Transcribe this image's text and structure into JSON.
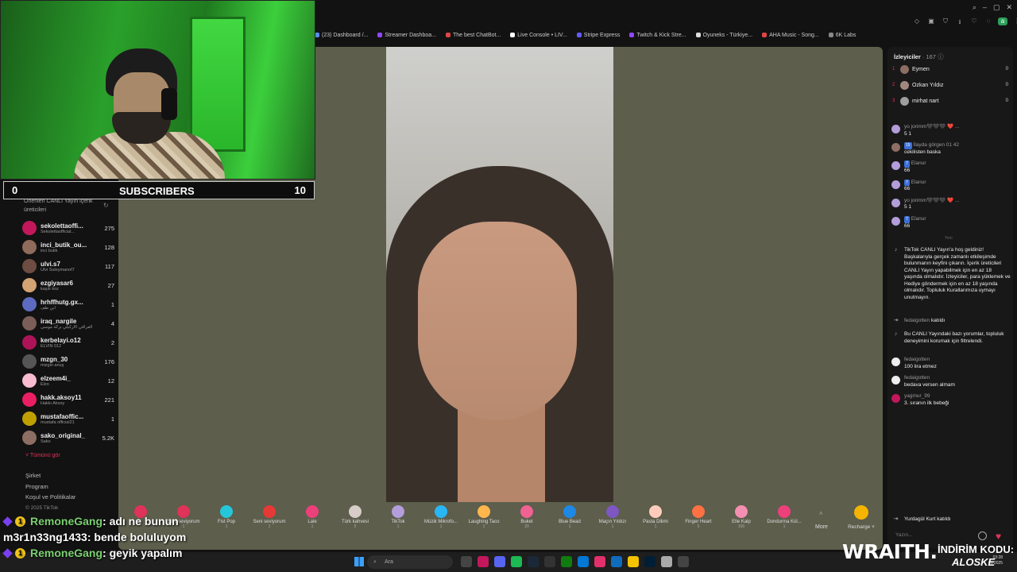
{
  "bookmarks": [
    {
      "label": "(23) Dashboard /...",
      "color": "#5a8dee"
    },
    {
      "label": "Streamer Dashboa...",
      "color": "#9146ff"
    },
    {
      "label": "The best ChatBot...",
      "color": "#e04545"
    },
    {
      "label": "Live Console • LIV...",
      "color": "#ffffff"
    },
    {
      "label": "Stripe Express",
      "color": "#635bff"
    },
    {
      "label": "Twitch & Kick Stre...",
      "color": "#9146ff"
    },
    {
      "label": "Oyuneks - Türkiye...",
      "color": "#dddddd"
    },
    {
      "label": "AHA Music - Song...",
      "color": "#e04545"
    },
    {
      "label": "6K Labs",
      "color": "#888888"
    }
  ],
  "overlay": {
    "sub_left": "0",
    "sub_label": "SUBSCRIBERS",
    "sub_right": "10"
  },
  "sidebar": {
    "heading": "Önerilen CANLI Yayın içerik üreticileri",
    "creators": [
      {
        "name": "sekolettaoffi...",
        "sub": "Sekolettaofficial...",
        "count": "275",
        "color": "#c2185b"
      },
      {
        "name": "inci_butik_ou...",
        "sub": "inci butik",
        "count": "128",
        "color": "#8e6b5a"
      },
      {
        "name": "ulvi.s7",
        "sub": "Ulvi Suleymanof7",
        "count": "117",
        "color": "#6d4c41"
      },
      {
        "name": "ezgiyasar6",
        "sub": "kaşık koz",
        "count": "27",
        "color": "#d4a373"
      },
      {
        "name": "hrhffhutg.gx...",
        "sub": "ابن طف",
        "count": "1",
        "color": "#5c6bc0"
      },
      {
        "name": "iraq_nargile",
        "sub": "العراقي الأركيلي بركة موسى",
        "count": "4",
        "color": "#7b5e57"
      },
      {
        "name": "kerbelayi.o12",
        "sub": "ELVIN 012",
        "count": "2",
        "color": "#ad1457"
      },
      {
        "name": "mzgn_30",
        "sub": "mizgin anuş",
        "count": "176",
        "color": "#555555"
      },
      {
        "name": "elzeem4i_",
        "sub": "Elzo",
        "count": "12",
        "color": "#f8bbd0"
      },
      {
        "name": "hakk.aksoy11",
        "sub": "Hakkı Aksoy",
        "count": "221",
        "color": "#e91e63"
      },
      {
        "name": "mustafaoffic...",
        "sub": "mustafa official21",
        "count": "1",
        "color": "#c0a000"
      },
      {
        "name": "sako_original_",
        "sub": "Sako",
        "count": "5.2K",
        "color": "#8d6e63"
      }
    ],
    "show_all": "Tümünü gör",
    "links": [
      "Şirket",
      "Program",
      "Koşul ve Politikalar"
    ],
    "copyright": "© 2025 TikTok"
  },
  "gifts": [
    {
      "name": "",
      "price": "1",
      "color": "#e0335a"
    },
    {
      "name": "Seni seviyorum",
      "price": "1",
      "color": "#e0335a"
    },
    {
      "name": "Fist Pop",
      "price": "1",
      "color": "#26c6da"
    },
    {
      "name": "Seni seviyorum",
      "price": "1",
      "color": "#e53935"
    },
    {
      "name": "Lale",
      "price": "1",
      "color": "#ec407a"
    },
    {
      "name": "Türk kahvesi",
      "price": "5",
      "color": "#d7ccc8"
    },
    {
      "name": "TikTok",
      "price": "1",
      "color": "#b39ddb"
    },
    {
      "name": "Müzik Mikrofo...",
      "price": "1",
      "color": "#29b6f6"
    },
    {
      "name": "Laughing Taco",
      "price": "1",
      "color": "#ffb74d"
    },
    {
      "name": "Buket",
      "price": "20",
      "color": "#f06292"
    },
    {
      "name": "Blue Bead",
      "price": "1",
      "color": "#1e88e5"
    },
    {
      "name": "Maçın Yıldızı",
      "price": "1",
      "color": "#7e57c2"
    },
    {
      "name": "Pasta Dilimi",
      "price": "1",
      "color": "#ffccbc"
    },
    {
      "name": "Finger Heart",
      "price": "5",
      "color": "#ff7043"
    },
    {
      "name": "Elle Kalp",
      "price": "100",
      "color": "#f48fb1"
    },
    {
      "name": "Dondurma Kül...",
      "price": "1",
      "color": "#ec407a"
    }
  ],
  "gift_more": "More",
  "recharge": "Recharge",
  "right": {
    "viewers_label": "İzleyiciler",
    "viewers_count": "· 167",
    "top": [
      {
        "rank": "1",
        "name": "Eymen",
        "score": "0",
        "color": "#8d6e63"
      },
      {
        "rank": "2",
        "name": "Ozkan Yıldız",
        "score": "0",
        "color": "#a1887f"
      },
      {
        "rank": "3",
        "name": "mirhat nart",
        "score": "0",
        "color": "#9e9e9e"
      }
    ],
    "messages": [
      {
        "user": "yo jorimm🖤🖤🖤 ❤️ ...",
        "text": "5 1",
        "color": "#b39ddb"
      },
      {
        "user": "İlayda görgen 01 42",
        "badge": "15",
        "text": "cekilisten baska",
        "color": "#8d6e63"
      },
      {
        "user": "Elanur",
        "badge": "7",
        "text": "66",
        "color": "#b39ddb"
      },
      {
        "user": "Elanur",
        "badge": "7",
        "text": "66",
        "color": "#b39ddb"
      },
      {
        "user": "yo jorimm🖤🖤🖤 ❤️ ...",
        "text": "5 1",
        "color": "#b39ddb"
      },
      {
        "user": "Elanur",
        "badge": "7",
        "text": "66",
        "color": "#b39ddb"
      }
    ],
    "new_label": "Yeni",
    "welcome": "TikTok CANLI Yayın'a hoş geldiniz! Başkalarıyla gerçek zamanlı etkileşimde bulunmanın keyfini çıkarın. İçerik üreticileri CANLI Yayın yapabilmek için en az 18 yaşında olmalıdır. İzleyiciler, para yüklemek ve Hediye göndermek için en az 18 yaşında olmalıdır. Topluluk Kurallarımıza uymayı unutmayın.",
    "join1_user": "fedaigotten",
    "join1_text": "katıldı",
    "filter_note": "Bu CANLI Yayındaki bazı yorumlar, topluluk deneyimini korumak için filtrelendi.",
    "msg2": [
      {
        "user": "fedaigotten",
        "text": "100 lira etmez",
        "color": "#eeeeee"
      },
      {
        "user": "fedaigotten",
        "text": "bedava versen almam",
        "color": "#eeeeee"
      },
      {
        "user": "yagmur_99",
        "text": "3. sıranın ilk bebeği",
        "color": "#c2185b"
      }
    ],
    "join2_user": "Yurdagül Kurt",
    "join2_text": "katıldı",
    "input_placeholder": "Yazın..."
  },
  "chat_overlay": [
    {
      "user": "RemoneGang",
      "text": ": adı ne bunun",
      "green": true,
      "badges": true
    },
    {
      "user": "m3r1n33ng1433",
      "text": ": bende boluluyom",
      "green": false,
      "badges": false
    },
    {
      "user": "RemoneGang",
      "text": ": geyik yapalım",
      "green": true,
      "badges": true
    }
  ],
  "taskbar": {
    "search_placeholder": "Ara"
  },
  "sponsor": {
    "brand": "WRAITH.",
    "code_label": "İNDİRİM KODU:",
    "code": "ALOSKE"
  },
  "clock": {
    "time": "03:28",
    "date": "01.2025"
  }
}
